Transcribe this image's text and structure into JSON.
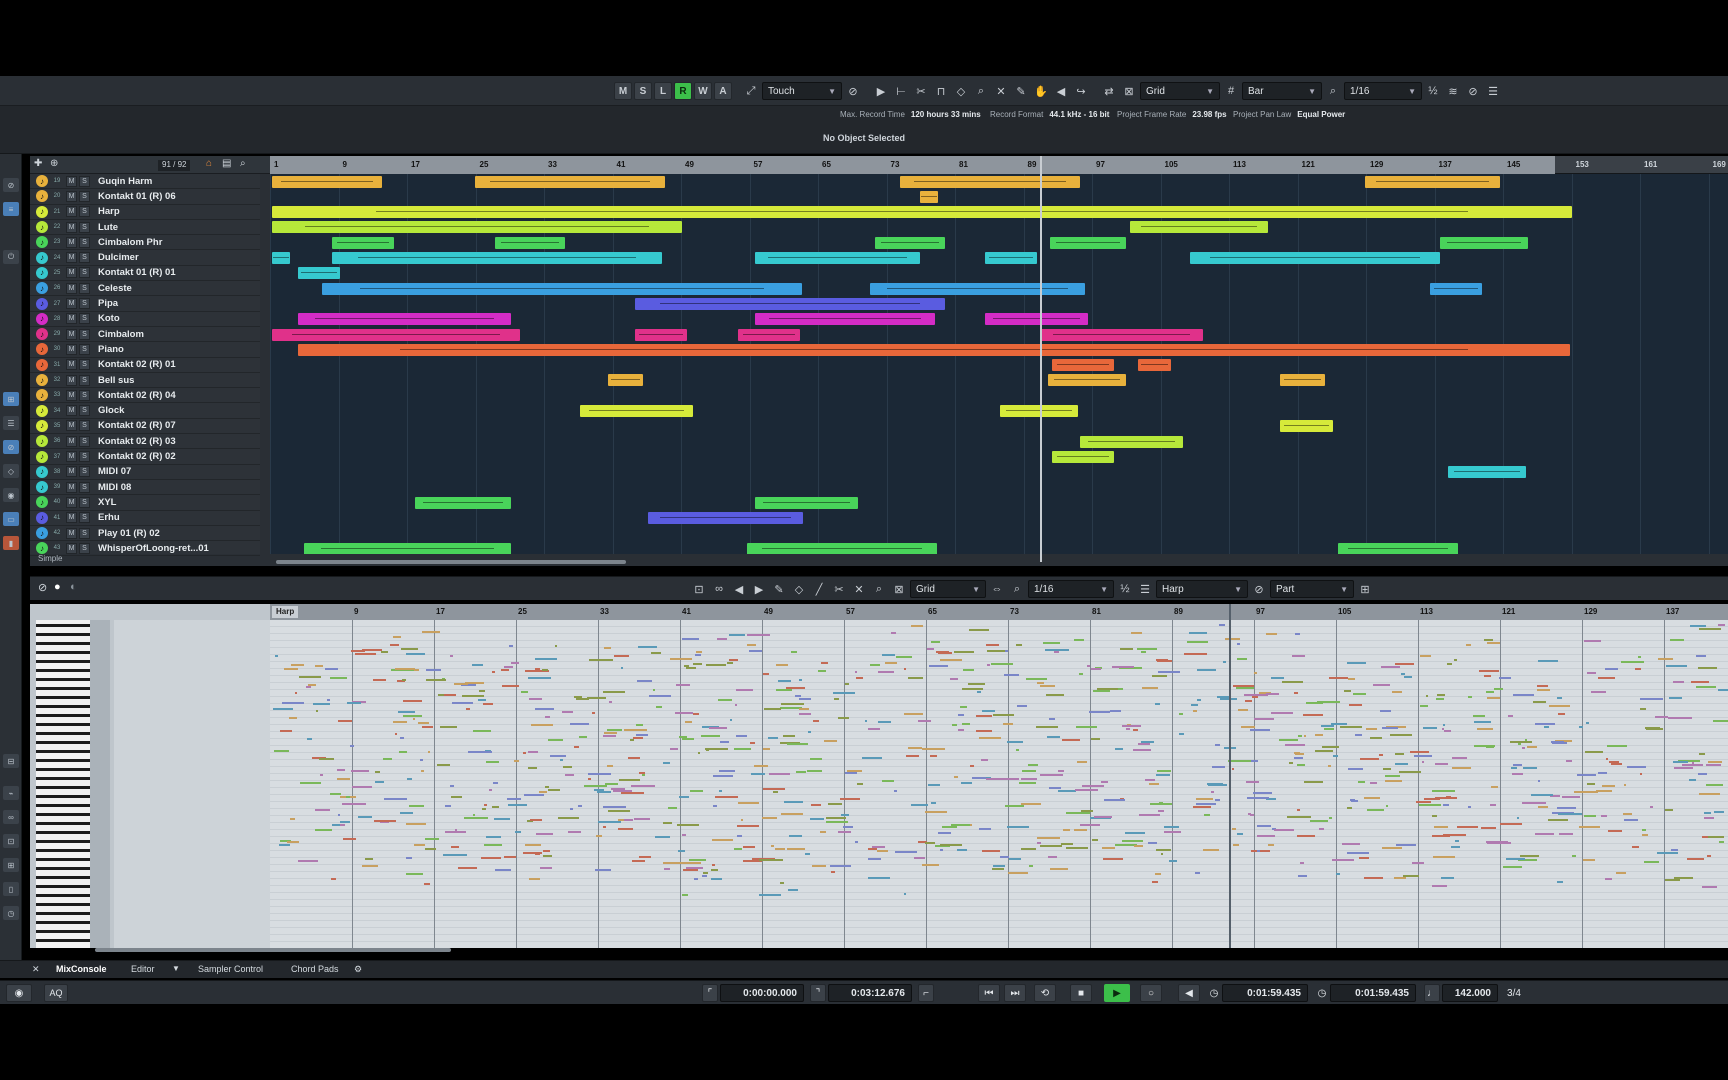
{
  "toolbar": {
    "state_buttons": [
      "M",
      "S",
      "L",
      "R",
      "W",
      "A"
    ],
    "automation_mode": "Touch",
    "snap_type": "Grid",
    "grid_type": "Bar",
    "quantize": "1/16"
  },
  "status": {
    "max_record_time_label": "Max. Record Time",
    "max_record_time": "120 hours 33 mins",
    "record_format_label": "Record Format",
    "record_format": "44.1 kHz - 16 bit",
    "frame_rate_label": "Project Frame Rate",
    "frame_rate": "23.98 fps",
    "pan_law_label": "Project Pan Law",
    "pan_law": "Equal Power",
    "selection": "No Object Selected"
  },
  "tracklist": {
    "counter": "91 / 92",
    "footer": "Simple",
    "tracks": [
      {
        "num": "19",
        "name": "Guqin Harm",
        "color": "#e8b13c"
      },
      {
        "num": "20",
        "name": "Kontakt 01 (R) 06",
        "color": "#e8b13c"
      },
      {
        "num": "21",
        "name": "Harp",
        "color": "#d6ea3a"
      },
      {
        "num": "22",
        "name": "Lute",
        "color": "#b6e83a"
      },
      {
        "num": "23",
        "name": "Cimbalom Phr",
        "color": "#49d45a"
      },
      {
        "num": "24",
        "name": "Dulcimer",
        "color": "#36c9cf"
      },
      {
        "num": "25",
        "name": "Kontakt 01 (R) 01",
        "color": "#36c9cf"
      },
      {
        "num": "26",
        "name": "Celeste",
        "color": "#3a9fe0"
      },
      {
        "num": "27",
        "name": "Pipa",
        "color": "#5a5ce0"
      },
      {
        "num": "28",
        "name": "Koto",
        "color": "#d42cc6"
      },
      {
        "num": "29",
        "name": "Cimbalom",
        "color": "#e0318a"
      },
      {
        "num": "30",
        "name": "Piano",
        "color": "#e8673a"
      },
      {
        "num": "31",
        "name": "Kontakt 02 (R) 01",
        "color": "#e8673a"
      },
      {
        "num": "32",
        "name": "Bell sus",
        "color": "#e8b13c"
      },
      {
        "num": "33",
        "name": "Kontakt 02 (R) 04",
        "color": "#e8b13c"
      },
      {
        "num": "34",
        "name": "Glock",
        "color": "#d6ea3a"
      },
      {
        "num": "35",
        "name": "Kontakt 02 (R) 07",
        "color": "#d6ea3a"
      },
      {
        "num": "36",
        "name": "Kontakt 02 (R) 03",
        "color": "#b6e83a"
      },
      {
        "num": "37",
        "name": "Kontakt 02 (R) 02",
        "color": "#b6e83a"
      },
      {
        "num": "38",
        "name": "MIDI 07",
        "color": "#36c9cf"
      },
      {
        "num": "39",
        "name": "MIDI 08",
        "color": "#36c9cf"
      },
      {
        "num": "40",
        "name": "XYL",
        "color": "#49d45a"
      },
      {
        "num": "41",
        "name": "Erhu",
        "color": "#5a5ce0"
      },
      {
        "num": "42",
        "name": "Play 01 (R) 02",
        "color": "#3a9fe0"
      },
      {
        "num": "43",
        "name": "WhisperOfLoong-ret...01",
        "color": "#49d45a"
      }
    ]
  },
  "ruler": {
    "bars": [
      "1",
      "9",
      "17",
      "25",
      "33",
      "41",
      "49",
      "57",
      "65",
      "73",
      "81",
      "89",
      "97",
      "105",
      "113",
      "121",
      "129",
      "137",
      "145",
      "153",
      "161",
      "169"
    ]
  },
  "editor": {
    "snap_type": "Grid",
    "quantize": "1/16",
    "track": "Harp",
    "part_mode": "Part",
    "part_label": "Harp",
    "bars": [
      "9",
      "17",
      "25",
      "33",
      "41",
      "49",
      "57",
      "65",
      "73",
      "81",
      "89",
      "97",
      "105",
      "113",
      "121",
      "129",
      "137"
    ]
  },
  "tabs": [
    "MixConsole",
    "Editor",
    "Sampler Control",
    "Chord Pads"
  ],
  "transport": {
    "aq": "AQ",
    "left_locator": "0:00:00.000",
    "right_locator": "0:03:12.676",
    "primary_time": "0:01:59.435",
    "secondary_time": "0:01:59.435",
    "tempo": "142.000",
    "signature": "3/4"
  }
}
